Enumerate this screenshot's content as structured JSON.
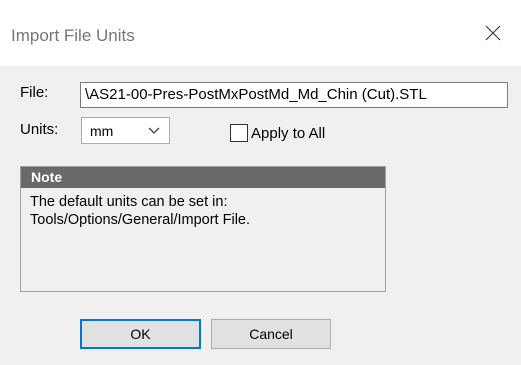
{
  "window": {
    "title": "Import File Units"
  },
  "file": {
    "label": "File:",
    "value": "\\AS21-00-Pres-PostMxPostMd_Md_Chin (Cut).STL"
  },
  "units": {
    "label": "Units:",
    "selected": "mm"
  },
  "apply_all": {
    "label": "Apply to All",
    "checked": false
  },
  "note": {
    "heading": "Note",
    "lines": [
      "The default units can be set in:",
      "Tools/Options/General/Import File."
    ]
  },
  "buttons": {
    "ok": "OK",
    "cancel": "Cancel"
  },
  "colors": {
    "note_header": "#696969",
    "focus_border": "#0078d7",
    "background": "#f0f0f0"
  }
}
